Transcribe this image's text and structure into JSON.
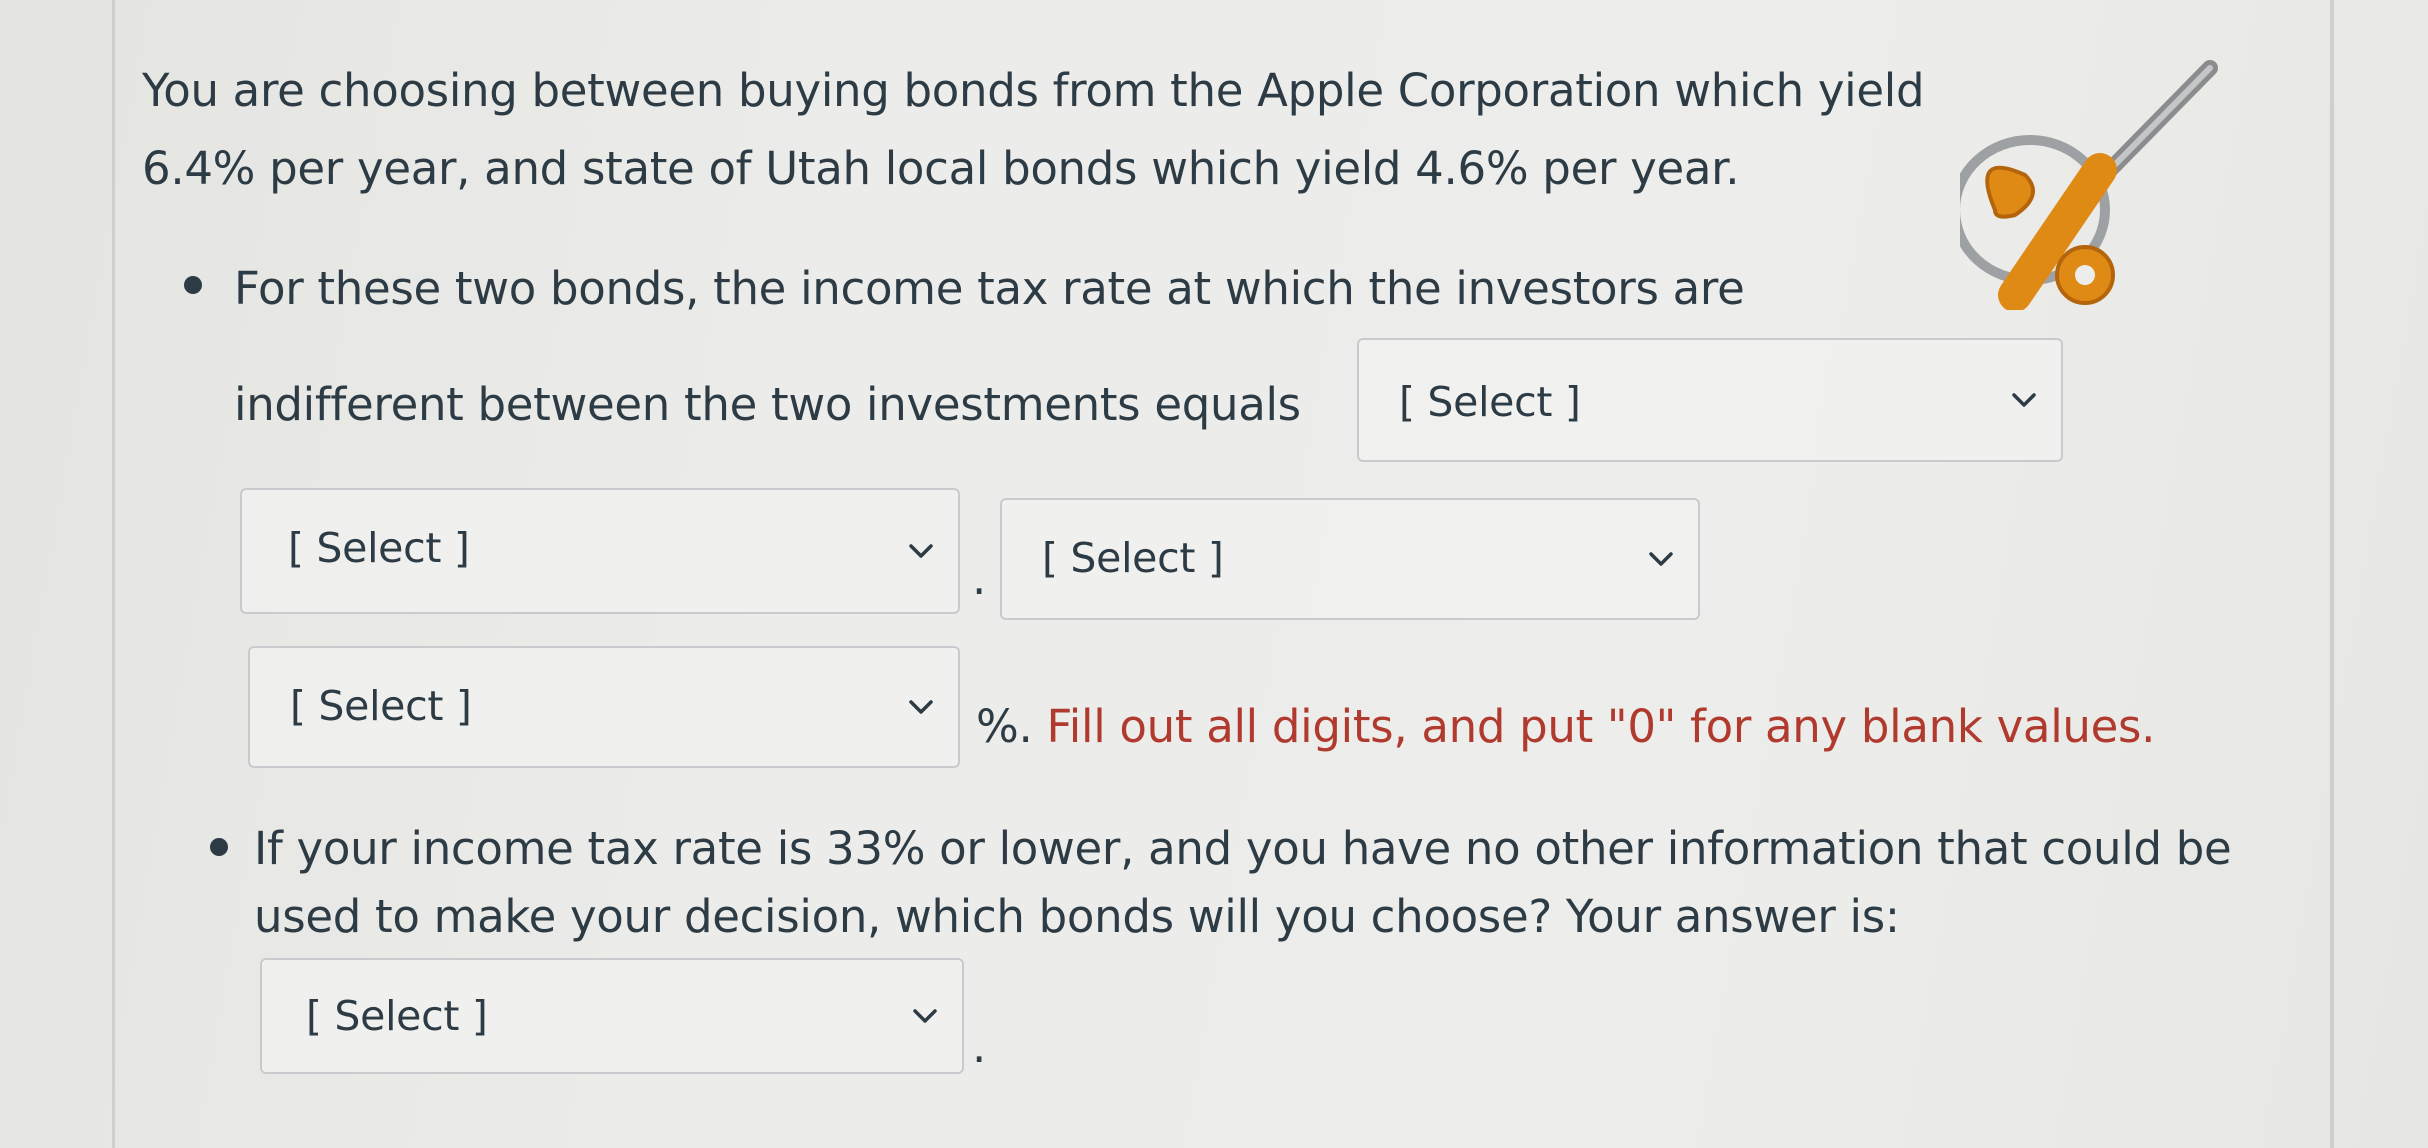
{
  "question": {
    "intro": "You are choosing between buying bonds from the Apple Corporation which yield 6.4% per year, and state of Utah local bonds which yield 4.6% per year.",
    "bullet1": {
      "line1": "For these two bonds, the income tax rate at which the investors are",
      "line2": "indifferent between the two investments  equals",
      "dot_separator": ".",
      "percent_prefix": "%.",
      "instruction": "Fill out all digits, and put \"0\" for any blank values."
    },
    "bullet2": {
      "line1": "If your income tax rate is 33% or lower, and you have no other information that could be",
      "line2": "used to make your decision, which bonds will you choose? Your answer is:",
      "trailing_dot": "."
    }
  },
  "dropdowns": {
    "select1": "[ Select ]",
    "select2": "[ Select ]",
    "select3": "[ Select ]",
    "select4": "[ Select ]",
    "select5": "[ Select ]"
  },
  "icons": {
    "percent_magnifier": "percent-magnifier-icon",
    "chevron": "chevron-down-icon"
  },
  "colors": {
    "text": "#2d3b45",
    "instruction_red": "#b03a2e",
    "badge_orange": "#e08a16"
  }
}
